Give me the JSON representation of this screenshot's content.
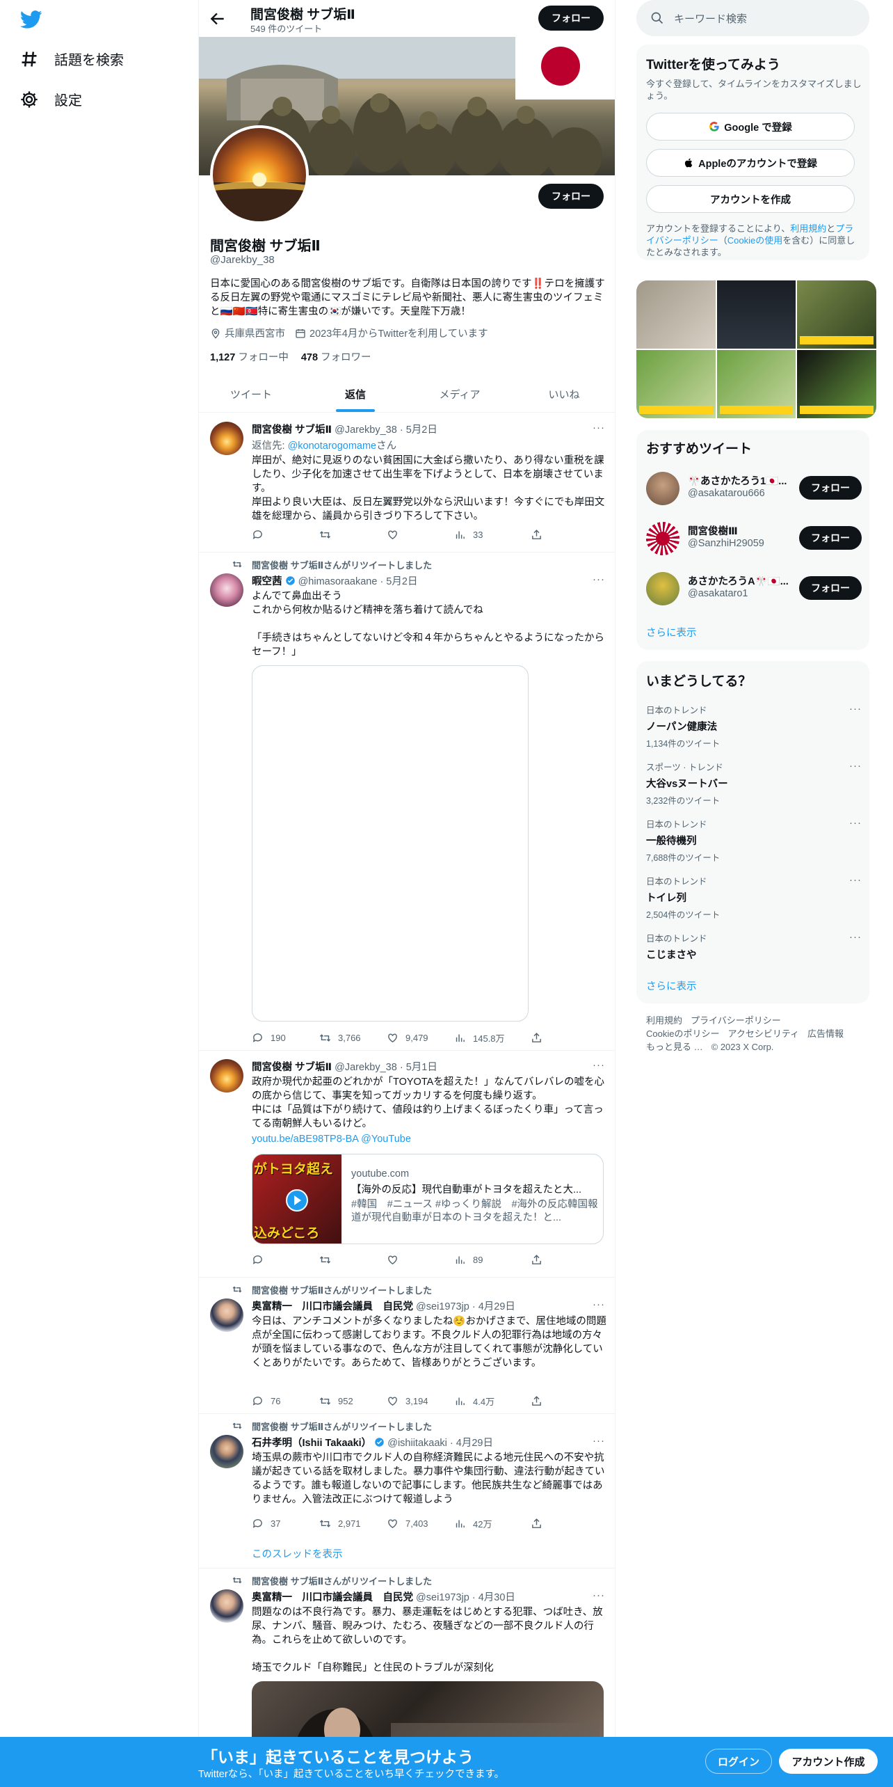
{
  "nav": {
    "items": [
      {
        "label": "話題を検索",
        "icon": "hashtag-icon"
      },
      {
        "label": "設定",
        "icon": "gear-icon"
      }
    ]
  },
  "header": {
    "name": "間宮俊樹 サブ垢Ⅱ",
    "tweet_count": "549 件のツイート",
    "follow_label": "フォロー"
  },
  "profile": {
    "name": "間宮俊樹 サブ垢Ⅱ",
    "handle": "@Jarekby_38",
    "follow_label": "フォロー",
    "bio": "日本に愛国心のある間宮俊樹のサブ垢です。自衛隊は日本国の誇りです‼️テロを擁護する反日左翼の野党や電通にマスゴミにテレビ局や新聞社、悪人に寄生害虫のツイフェミと🇷🇺🇨🇳🇰🇵特に寄生害虫の🇰🇷が嫌いです。天皇陛下万歳！",
    "location": "兵庫県西宮市",
    "joined": "2023年4月からTwitterを利用しています",
    "following_count": "1,127",
    "following_label": "フォロー中",
    "followers_count": "478",
    "followers_label": "フォロワー"
  },
  "tabs": [
    "ツイート",
    "返信",
    "メディア",
    "いいね"
  ],
  "active_tab": "返信",
  "tweets": [
    {
      "name": "間宮俊樹 サブ垢Ⅱ",
      "handle": "@Jarekby_38 · 5月2日",
      "reply_prefix": "返信先: ",
      "reply_to": "@konotarogomame",
      "reply_suffix": "さん",
      "text": "岸田が、絶対に見返りのない貧困国に大金ばら撒いたり、あり得ない重税を課したり、少子化を加速させて出生率を下げようとして、日本を崩壊させています。\n岸田より良い大臣は、反日左翼野党以外なら沢山います！今すぐにでも岸田文雄を総理から、議員から引きづり下ろして下さい。",
      "views": "33"
    },
    {
      "retweet_label": "間宮俊樹 サブ垢Ⅱさんがリツイートしました",
      "name": "暇空茜",
      "handle": "@himasoraakane · 5月2日",
      "text": "よんでて鼻血出そう\nこれから何枚か貼るけど精神を落ち着けて読んでね\n\n「手続きはちゃんとしてないけど令和４年からちゃんとやるようになったからセーフ！」",
      "replies": "190",
      "retweets": "3,766",
      "likes": "9,479",
      "views": "145.8万"
    },
    {
      "name": "間宮俊樹 サブ垢Ⅱ",
      "handle": "@Jarekby_38 · 5月1日",
      "text": "政府か現代か起亜のどれかが「TOYOTAを超えた！」なんてバレバレの嘘を心の底から信じて、事実を知ってガッカリするを何度も繰り返す。\n中には「品質は下がり続けて、値段は釣り上げまくるぼったくり車」って言ってる南朝鮮人もいるけど。",
      "link": "youtu.be/aBE98TP8-BA @YouTube",
      "card_domain": "youtube.com",
      "card_title": "【海外の反応】現代自動車がトヨタを超えたと大...",
      "card_desc": "#韓国　#ニュース #ゆっくり解説　#海外の反応韓国報道が現代自動車が日本のトヨタを超えた！と...",
      "thumb_text": "がトヨタ超え",
      "thumb_text2": "込みどころ",
      "views": "89"
    },
    {
      "retweet_label": "間宮俊樹 サブ垢Ⅱさんがリツイートしました",
      "name": "奥富精一　川口市議会議員　自民党",
      "handle": "@sei1973jp · 4月29日",
      "text": "今日は、アンチコメントが多くなりましたね☺️おかげさまで、居住地域の問題点が全国に伝わって感謝しております。不良クルド人の犯罪行為は地域の方々が頭を悩ましている事なので、色んな方が注目してくれて事態が沈静化していくとありがたいです。あらためて、皆様ありがとうございます。",
      "replies": "76",
      "retweets": "952",
      "likes": "3,194",
      "views": "4.4万"
    },
    {
      "retweet_label": "間宮俊樹 サブ垢Ⅱさんがリツイートしました",
      "name": "石井孝明（Ishii Takaaki）",
      "handle": "@ishiitakaaki · 4月29日",
      "text": "埼玉県の蕨市や川口市でクルド人の自称経済難民による地元住民への不安や抗議が起きている話を取材しました。暴力事件や集団行動、違法行動が起きているようです。誰も報道しないので記事にします。他民族共生など綺麗事ではありません。入管法改正にぶつけて報道しよう",
      "replies": "37",
      "retweets": "2,971",
      "likes": "7,403",
      "views": "42万",
      "thread_label": "このスレッドを表示"
    },
    {
      "retweet_label": "間宮俊樹 サブ垢Ⅱさんがリツイートしました",
      "name": "奥富精一　川口市議会議員　自民党",
      "handle": "@sei1973jp · 4月30日",
      "text": "問題なのは不良行為です。暴力、暴走運転をはじめとする犯罪、つば吐き、放尿、ナンパ、騒音、睨みつけ、たむろ、夜騒ぎなどの一部不良クルド人の行為。これらを止めて欲しいのです。\n\n埼玉でクルド「自称難民」と住民のトラブルが深刻化"
    }
  ],
  "right": {
    "search_placeholder": "キーワード検索",
    "signup": {
      "title": "Twitterを使ってみよう",
      "subtitle": "今すぐ登録して、タイムラインをカスタマイズしましょう。",
      "google": "Google で登録",
      "apple": "Appleのアカウントで登録",
      "create": "アカウントを作成",
      "legal_1": "アカウントを登録することにより、",
      "legal_terms": "利用規約",
      "legal_2": "と",
      "legal_privacy": "プライバシーポリシー",
      "legal_3": "（",
      "legal_cookie": "Cookieの使用",
      "legal_4": "を含む）に同意したとみなされます。"
    },
    "recommend": {
      "title": "おすすめツイート",
      "follow_label": "フォロー",
      "show_more": "さらに表示",
      "users": [
        {
          "name": "🎌あさかたろう1🇯🇵...",
          "handle": "@asakatarou666"
        },
        {
          "name": "間宮俊樹Ⅲ",
          "handle": "@SanzhiH29059"
        },
        {
          "name": "あさかたろうA🎌🇯🇵...",
          "handle": "@asakataro1"
        }
      ]
    },
    "trends": {
      "title": "いまどうしてる？",
      "show_more": "さらに表示",
      "items": [
        {
          "category": "日本のトレンド",
          "topic": "ノーパン健康法",
          "count": "1,134件のツイート"
        },
        {
          "category": "スポーツ · トレンド",
          "topic": "大谷vsヌートバー",
          "count": "3,232件のツイート"
        },
        {
          "category": "日本のトレンド",
          "topic": "一般待機列",
          "count": "7,688件のツイート"
        },
        {
          "category": "日本のトレンド",
          "topic": "トイレ列",
          "count": "2,504件のツイート"
        },
        {
          "category": "日本のトレンド",
          "topic": "こじまさや",
          "count": ""
        }
      ]
    },
    "footer": [
      "利用規約",
      "プライバシーポリシー",
      "Cookieのポリシー",
      "アクセシビリティ",
      "広告情報",
      "もっと見る …",
      "© 2023 X Corp."
    ]
  },
  "bottom": {
    "title": "「いま」起きていることを見つけよう",
    "subtitle": "Twitterなら、「いま」起きていることをいち早くチェックできます。",
    "login": "ログイン",
    "signup": "アカウント作成"
  },
  "colors": {
    "accent": "#1d9bf0",
    "text": "#0f1419",
    "muted": "#536471"
  }
}
